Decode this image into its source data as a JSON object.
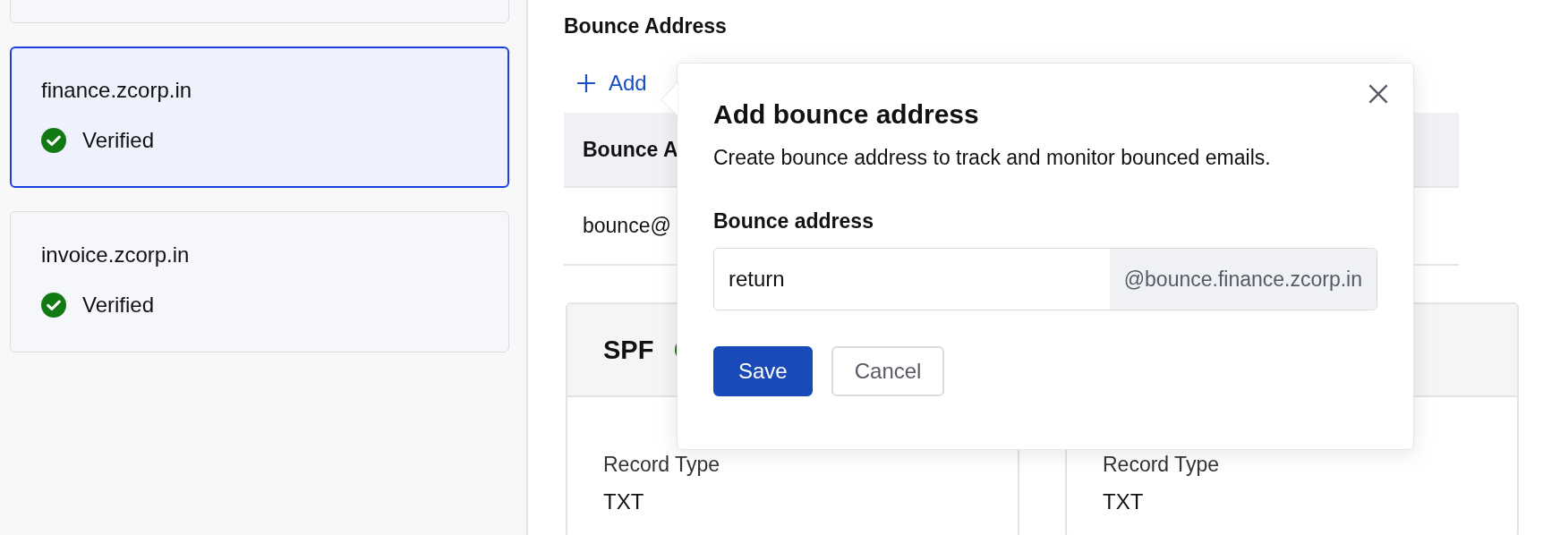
{
  "domains": [
    {
      "selected": false
    },
    {
      "name": "finance.zcorp.in",
      "status": "Verified",
      "verified": true,
      "selected": true
    },
    {
      "name": "invoice.zcorp.in",
      "status": "Verified",
      "verified": true,
      "selected": false
    }
  ],
  "section_title": "Bounce Address",
  "add_link": "Add",
  "table": {
    "columns": [
      "Bounce A"
    ],
    "rows": [
      [
        "bounce@"
      ]
    ]
  },
  "record_cards": [
    {
      "title": "SPF",
      "verified": true,
      "field_label": "Record Type",
      "field_value": "TXT"
    },
    {
      "field_label": "Record Type",
      "field_value": "TXT"
    }
  ],
  "dialog": {
    "title": "Add bounce address",
    "description": "Create bounce address to track and monitor bounced emails.",
    "field_label": "Bounce address",
    "value": "return",
    "suffix": "@bounce.finance.zcorp.in",
    "buttons": [
      "Save",
      "Cancel"
    ]
  }
}
